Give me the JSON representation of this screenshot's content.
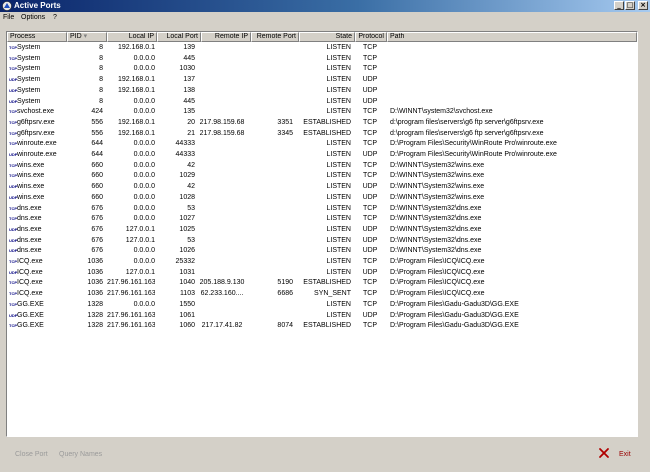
{
  "window": {
    "title": "Active Ports",
    "btn_min": "_",
    "btn_max": "□",
    "btn_close": "×"
  },
  "menu": {
    "file": "File",
    "options": "Options",
    "help": "?"
  },
  "columns": {
    "process": "Process",
    "pid": "PID",
    "local_ip": "Local IP",
    "local_port": "Local Port",
    "remote_ip": "Remote IP",
    "remote_port": "Remote Port",
    "state": "State",
    "protocol": "Protocol",
    "path": "Path"
  },
  "rows": [
    {
      "tag": "TCP",
      "process": "System",
      "pid": "8",
      "local_ip": "192.168.0.1",
      "local_port": "139",
      "remote_ip": "",
      "remote_port": "",
      "state": "LISTEN",
      "protocol": "TCP",
      "path": ""
    },
    {
      "tag": "TCP",
      "process": "System",
      "pid": "8",
      "local_ip": "0.0.0.0",
      "local_port": "445",
      "remote_ip": "",
      "remote_port": "",
      "state": "LISTEN",
      "protocol": "TCP",
      "path": ""
    },
    {
      "tag": "TCP",
      "process": "System",
      "pid": "8",
      "local_ip": "0.0.0.0",
      "local_port": "1030",
      "remote_ip": "",
      "remote_port": "",
      "state": "LISTEN",
      "protocol": "TCP",
      "path": ""
    },
    {
      "tag": "UDP",
      "process": "System",
      "pid": "8",
      "local_ip": "192.168.0.1",
      "local_port": "137",
      "remote_ip": "",
      "remote_port": "",
      "state": "LISTEN",
      "protocol": "UDP",
      "path": ""
    },
    {
      "tag": "UDP",
      "process": "System",
      "pid": "8",
      "local_ip": "192.168.0.1",
      "local_port": "138",
      "remote_ip": "",
      "remote_port": "",
      "state": "LISTEN",
      "protocol": "UDP",
      "path": ""
    },
    {
      "tag": "UDP",
      "process": "System",
      "pid": "8",
      "local_ip": "0.0.0.0",
      "local_port": "445",
      "remote_ip": "",
      "remote_port": "",
      "state": "LISTEN",
      "protocol": "UDP",
      "path": ""
    },
    {
      "tag": "TCP",
      "process": "svchost.exe",
      "pid": "424",
      "local_ip": "0.0.0.0",
      "local_port": "135",
      "remote_ip": "",
      "remote_port": "",
      "state": "LISTEN",
      "protocol": "TCP",
      "path": "D:\\WINNT\\system32\\svchost.exe"
    },
    {
      "tag": "TCP",
      "process": "g6ftpsrv.exe",
      "pid": "556",
      "local_ip": "192.168.0.1",
      "local_port": "20",
      "remote_ip": "217.98.159.68",
      "remote_port": "3351",
      "state": "ESTABLISHED",
      "protocol": "TCP",
      "path": "d:\\program files\\servers\\g6 ftp server\\g6ftpsrv.exe"
    },
    {
      "tag": "TCP",
      "process": "g6ftpsrv.exe",
      "pid": "556",
      "local_ip": "192.168.0.1",
      "local_port": "21",
      "remote_ip": "217.98.159.68",
      "remote_port": "3345",
      "state": "ESTABLISHED",
      "protocol": "TCP",
      "path": "d:\\program files\\servers\\g6 ftp server\\g6ftpsrv.exe"
    },
    {
      "tag": "TCP",
      "process": "winroute.exe",
      "pid": "644",
      "local_ip": "0.0.0.0",
      "local_port": "44333",
      "remote_ip": "",
      "remote_port": "",
      "state": "LISTEN",
      "protocol": "TCP",
      "path": "D:\\Program Files\\Security\\WinRoute Pro\\winroute.exe"
    },
    {
      "tag": "UDP",
      "process": "winroute.exe",
      "pid": "644",
      "local_ip": "0.0.0.0",
      "local_port": "44333",
      "remote_ip": "",
      "remote_port": "",
      "state": "LISTEN",
      "protocol": "UDP",
      "path": "D:\\Program Files\\Security\\WinRoute Pro\\winroute.exe"
    },
    {
      "tag": "TCP",
      "process": "wins.exe",
      "pid": "660",
      "local_ip": "0.0.0.0",
      "local_port": "42",
      "remote_ip": "",
      "remote_port": "",
      "state": "LISTEN",
      "protocol": "TCP",
      "path": "D:\\WINNT\\System32\\wins.exe"
    },
    {
      "tag": "TCP",
      "process": "wins.exe",
      "pid": "660",
      "local_ip": "0.0.0.0",
      "local_port": "1029",
      "remote_ip": "",
      "remote_port": "",
      "state": "LISTEN",
      "protocol": "TCP",
      "path": "D:\\WINNT\\System32\\wins.exe"
    },
    {
      "tag": "UDP",
      "process": "wins.exe",
      "pid": "660",
      "local_ip": "0.0.0.0",
      "local_port": "42",
      "remote_ip": "",
      "remote_port": "",
      "state": "LISTEN",
      "protocol": "UDP",
      "path": "D:\\WINNT\\System32\\wins.exe"
    },
    {
      "tag": "UDP",
      "process": "wins.exe",
      "pid": "660",
      "local_ip": "0.0.0.0",
      "local_port": "1028",
      "remote_ip": "",
      "remote_port": "",
      "state": "LISTEN",
      "protocol": "UDP",
      "path": "D:\\WINNT\\System32\\wins.exe"
    },
    {
      "tag": "TCP",
      "process": "dns.exe",
      "pid": "676",
      "local_ip": "0.0.0.0",
      "local_port": "53",
      "remote_ip": "",
      "remote_port": "",
      "state": "LISTEN",
      "protocol": "TCP",
      "path": "D:\\WINNT\\System32\\dns.exe"
    },
    {
      "tag": "TCP",
      "process": "dns.exe",
      "pid": "676",
      "local_ip": "0.0.0.0",
      "local_port": "1027",
      "remote_ip": "",
      "remote_port": "",
      "state": "LISTEN",
      "protocol": "TCP",
      "path": "D:\\WINNT\\System32\\dns.exe"
    },
    {
      "tag": "UDP",
      "process": "dns.exe",
      "pid": "676",
      "local_ip": "127.0.0.1",
      "local_port": "1025",
      "remote_ip": "",
      "remote_port": "",
      "state": "LISTEN",
      "protocol": "UDP",
      "path": "D:\\WINNT\\System32\\dns.exe"
    },
    {
      "tag": "UDP",
      "process": "dns.exe",
      "pid": "676",
      "local_ip": "127.0.0.1",
      "local_port": "53",
      "remote_ip": "",
      "remote_port": "",
      "state": "LISTEN",
      "protocol": "UDP",
      "path": "D:\\WINNT\\System32\\dns.exe"
    },
    {
      "tag": "UDP",
      "process": "dns.exe",
      "pid": "676",
      "local_ip": "0.0.0.0",
      "local_port": "1026",
      "remote_ip": "",
      "remote_port": "",
      "state": "LISTEN",
      "protocol": "UDP",
      "path": "D:\\WINNT\\System32\\dns.exe"
    },
    {
      "tag": "TCP",
      "process": "ICQ.exe",
      "pid": "1036",
      "local_ip": "0.0.0.0",
      "local_port": "25332",
      "remote_ip": "",
      "remote_port": "",
      "state": "LISTEN",
      "protocol": "TCP",
      "path": "D:\\Program Files\\ICQ\\ICQ.exe"
    },
    {
      "tag": "UDP",
      "process": "ICQ.exe",
      "pid": "1036",
      "local_ip": "127.0.0.1",
      "local_port": "1031",
      "remote_ip": "",
      "remote_port": "",
      "state": "LISTEN",
      "protocol": "UDP",
      "path": "D:\\Program Files\\ICQ\\ICQ.exe"
    },
    {
      "tag": "TCP",
      "process": "ICQ.exe",
      "pid": "1036",
      "local_ip": "217.96.161.163",
      "local_port": "1040",
      "remote_ip": "205.188.9.130",
      "remote_port": "5190",
      "state": "ESTABLISHED",
      "protocol": "TCP",
      "path": "D:\\Program Files\\ICQ\\ICQ.exe"
    },
    {
      "tag": "TCP",
      "process": "ICQ.exe",
      "pid": "1036",
      "local_ip": "217.96.161.163",
      "local_port": "1103",
      "remote_ip": "62.233.160....",
      "remote_port": "6686",
      "state": "SYN_SENT",
      "protocol": "TCP",
      "path": "D:\\Program Files\\ICQ\\ICQ.exe"
    },
    {
      "tag": "TCP",
      "process": "GG.EXE",
      "pid": "1328",
      "local_ip": "0.0.0.0",
      "local_port": "1550",
      "remote_ip": "",
      "remote_port": "",
      "state": "LISTEN",
      "protocol": "TCP",
      "path": "D:\\Program Files\\Gadu-Gadu3D\\GG.EXE"
    },
    {
      "tag": "UDP",
      "process": "GG.EXE",
      "pid": "1328",
      "local_ip": "217.96.161.163",
      "local_port": "1061",
      "remote_ip": "",
      "remote_port": "",
      "state": "LISTEN",
      "protocol": "UDP",
      "path": "D:\\Program Files\\Gadu-Gadu3D\\GG.EXE"
    },
    {
      "tag": "TCP",
      "process": "GG.EXE",
      "pid": "1328",
      "local_ip": "217.96.161.163",
      "local_port": "1060",
      "remote_ip": "217.17.41.82",
      "remote_port": "8074",
      "state": "ESTABLISHED",
      "protocol": "TCP",
      "path": "D:\\Program Files\\Gadu-Gadu3D\\GG.EXE"
    }
  ],
  "footer": {
    "close_port": "Close Port",
    "query_names": "Query Names",
    "exit": "Exit"
  }
}
